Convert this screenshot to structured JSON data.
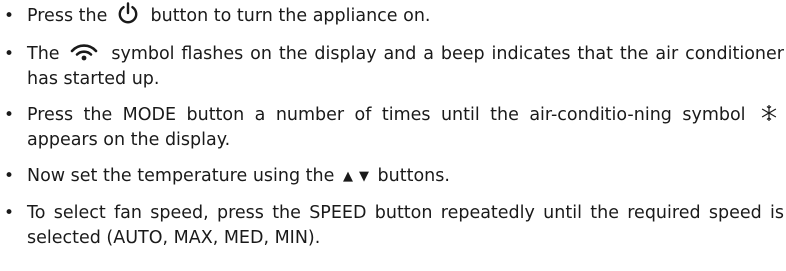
{
  "instructions": [
    {
      "bullet": "•",
      "before": "Press the",
      "icon": "power-icon",
      "after": "button to turn the appliance on."
    },
    {
      "bullet": "•",
      "before": "The",
      "icon": "wifi-signal-icon",
      "after": "symbol flashes on the display and a beep indicates that the air conditioner has started up."
    },
    {
      "bullet": "•",
      "before": "Press the MODE button a number of times until the air-conditio-ning symbol",
      "icon": "snowflake-icon",
      "after": "appears on the display."
    },
    {
      "bullet": "•",
      "before": "Now set the temperature using the",
      "up_arrow": "▲",
      "down_arrow": "▼",
      "after": "buttons."
    },
    {
      "bullet": "•",
      "text": "To select fan speed, press the SPEED button repeatedly until the required speed is selected (AUTO, MAX, MED, MIN)."
    }
  ]
}
